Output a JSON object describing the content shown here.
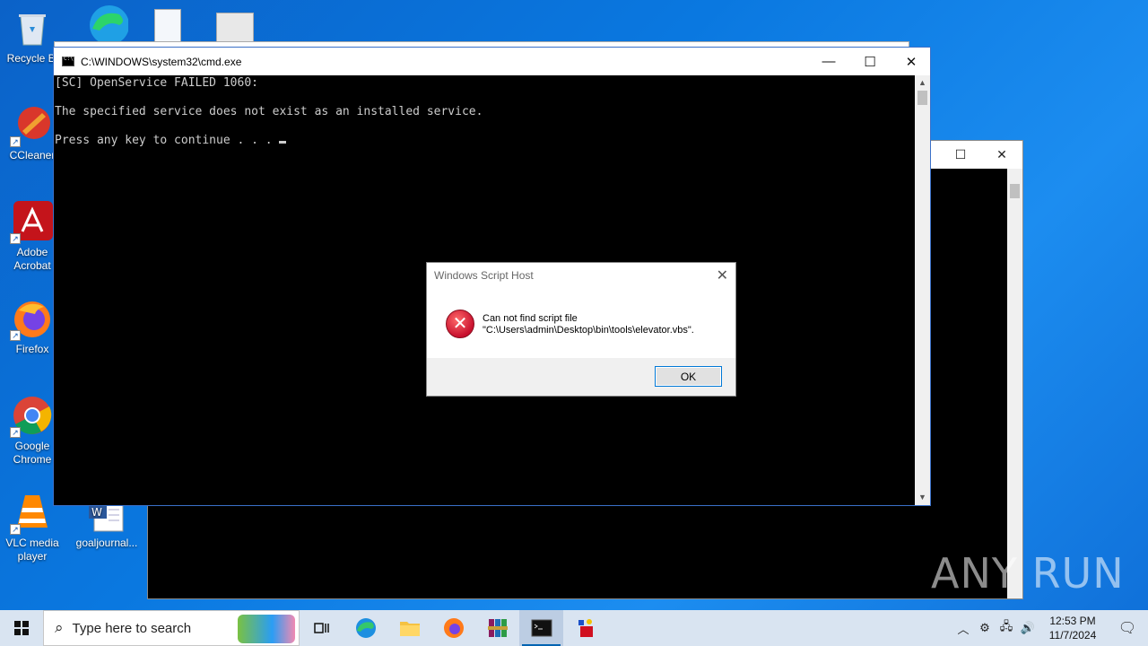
{
  "desktop_icons": [
    {
      "label": "Recycle Bi",
      "icon": "recycle-bin-icon"
    },
    {
      "label": "CCleaner",
      "icon": "ccleaner-icon"
    },
    {
      "label": "Adobe Acrobat",
      "icon": "acrobat-icon"
    },
    {
      "label": "Firefox",
      "icon": "firefox-icon"
    },
    {
      "label": "Google Chrome",
      "icon": "chrome-icon"
    },
    {
      "label": "VLC media player",
      "icon": "vlc-icon"
    },
    {
      "label": "goaljournal...",
      "icon": "word-doc-icon"
    }
  ],
  "cmd_window": {
    "title": "C:\\WINDOWS\\system32\\cmd.exe",
    "lines": [
      "[SC] OpenService FAILED 1060:",
      "The specified service does not exist as an installed service.",
      "Press any key to continue . . . "
    ],
    "minimize": "—",
    "maximize": "☐",
    "close": "✕"
  },
  "background_window": {
    "maximize": "☐",
    "close": "✕"
  },
  "dialog": {
    "title": "Windows Script Host",
    "close": "✕",
    "message_line1": "Can not find script file",
    "message_line2": "\"C:\\Users\\admin\\Desktop\\bin\\tools\\elevator.vbs\".",
    "ok_label": "OK",
    "icon": "error-icon"
  },
  "watermark": "ANY RUN",
  "taskbar": {
    "search_placeholder": "Type here to search",
    "apps": [
      "task-view",
      "edge",
      "file-explorer",
      "firefox",
      "winrar",
      "cmd",
      "app-launcher"
    ],
    "active_app": "cmd",
    "time": "12:53 PM",
    "date": "11/7/2024"
  },
  "colors": {
    "desktop": "#0a78e0",
    "console_bg": "#000000",
    "console_text": "#cccccc",
    "accent": "#0078d7"
  }
}
